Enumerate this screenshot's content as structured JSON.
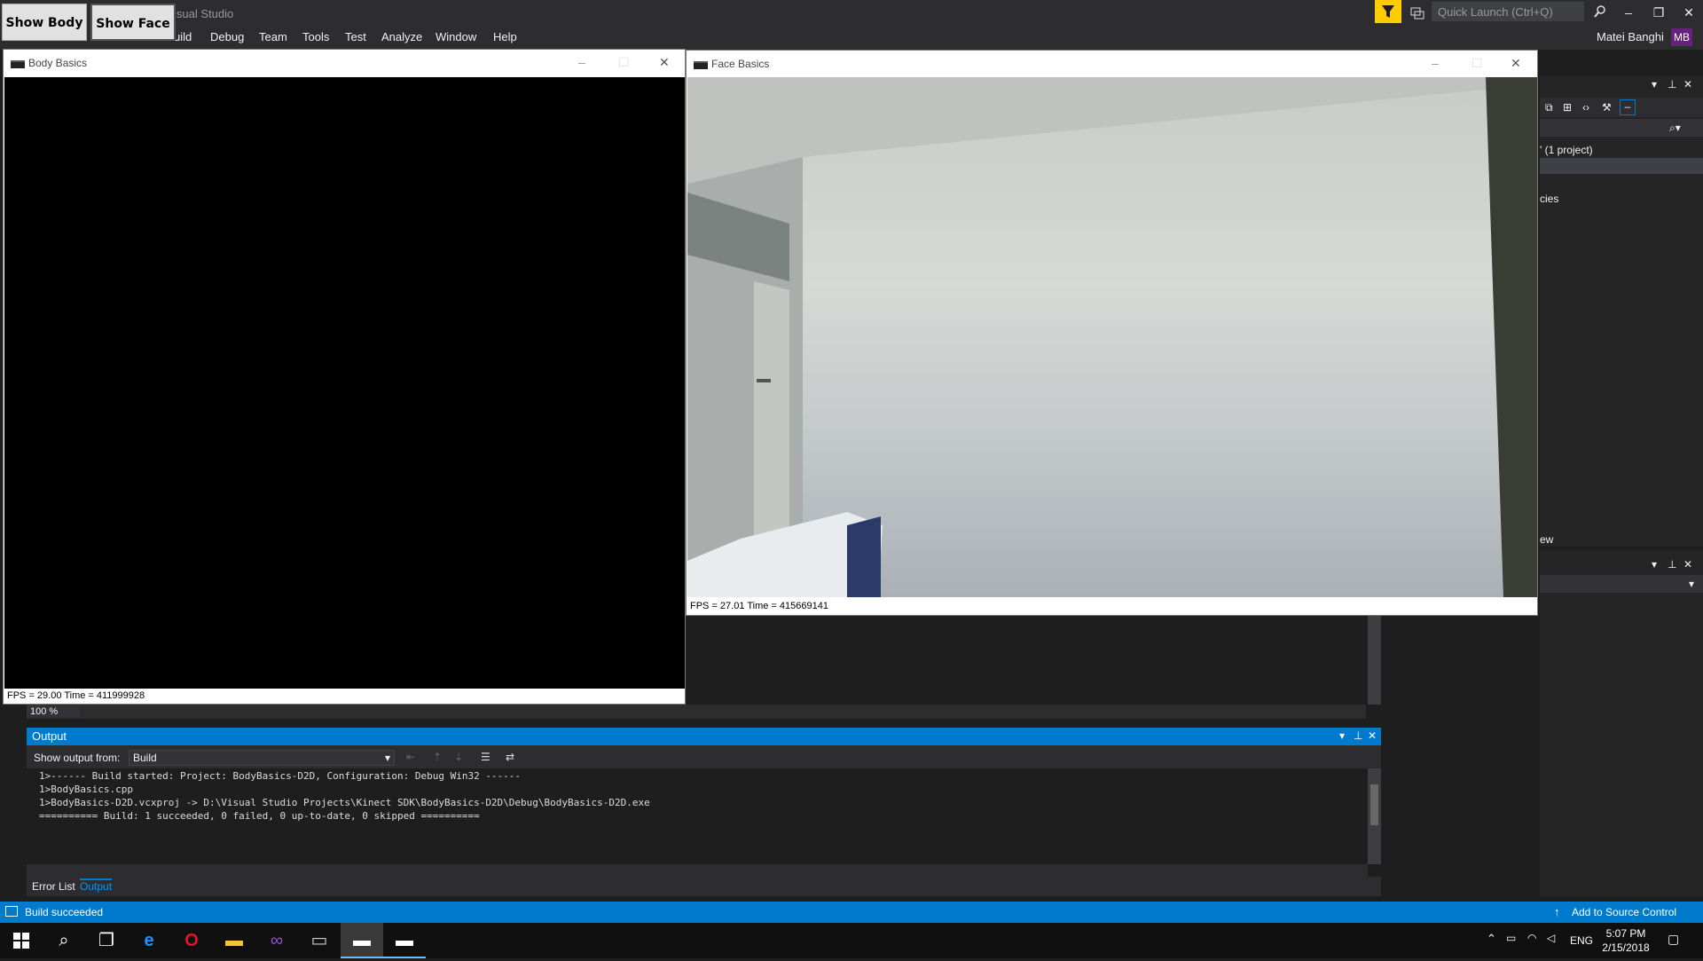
{
  "vs": {
    "title": "isual Studio",
    "menu": [
      "uild",
      "Debug",
      "Team",
      "Tools",
      "Test",
      "Analyze",
      "Window",
      "Help"
    ],
    "quick_launch_placeholder": "Quick Launch (Ctrl+Q)",
    "user_name": "Matei Banghi",
    "user_initials": "MB"
  },
  "buttons": {
    "show_body": "Show Body",
    "show_face": "Show Face"
  },
  "solution_panel": {
    "project_text": "' (1 project)",
    "deps_text": "cies",
    "view_text": "ew"
  },
  "editor": {
    "zoom": "100 %"
  },
  "output": {
    "title": "Output",
    "show_from_label": "Show output from:",
    "source": "Build",
    "lines": [
      "1>------ Build started: Project: BodyBasics-D2D, Configuration: Debug Win32 ------",
      "1>BodyBasics.cpp",
      "1>BodyBasics-D2D.vcxproj -> D:\\Visual Studio Projects\\Kinect SDK\\BodyBasics-D2D\\Debug\\BodyBasics-D2D.exe",
      "========== Build: 1 succeeded, 0 failed, 0 up-to-date, 0 skipped =========="
    ]
  },
  "bottom_tabs": {
    "error_list": "Error List",
    "output": "Output"
  },
  "status": {
    "text": "Build succeeded",
    "source_control": "Add to Source Control"
  },
  "body_window": {
    "title": "Body Basics",
    "status": "FPS = 29.00    Time = 411999928"
  },
  "face_window": {
    "title": "Face Basics",
    "status": "FPS = 27.01    Time = 415669141"
  },
  "tray": {
    "lang": "ENG",
    "time": "5:07 PM",
    "date": "2/15/2018"
  },
  "colors": {
    "accent": "#007acc",
    "filter": "#ffcc00",
    "avatar": "#68217a"
  }
}
